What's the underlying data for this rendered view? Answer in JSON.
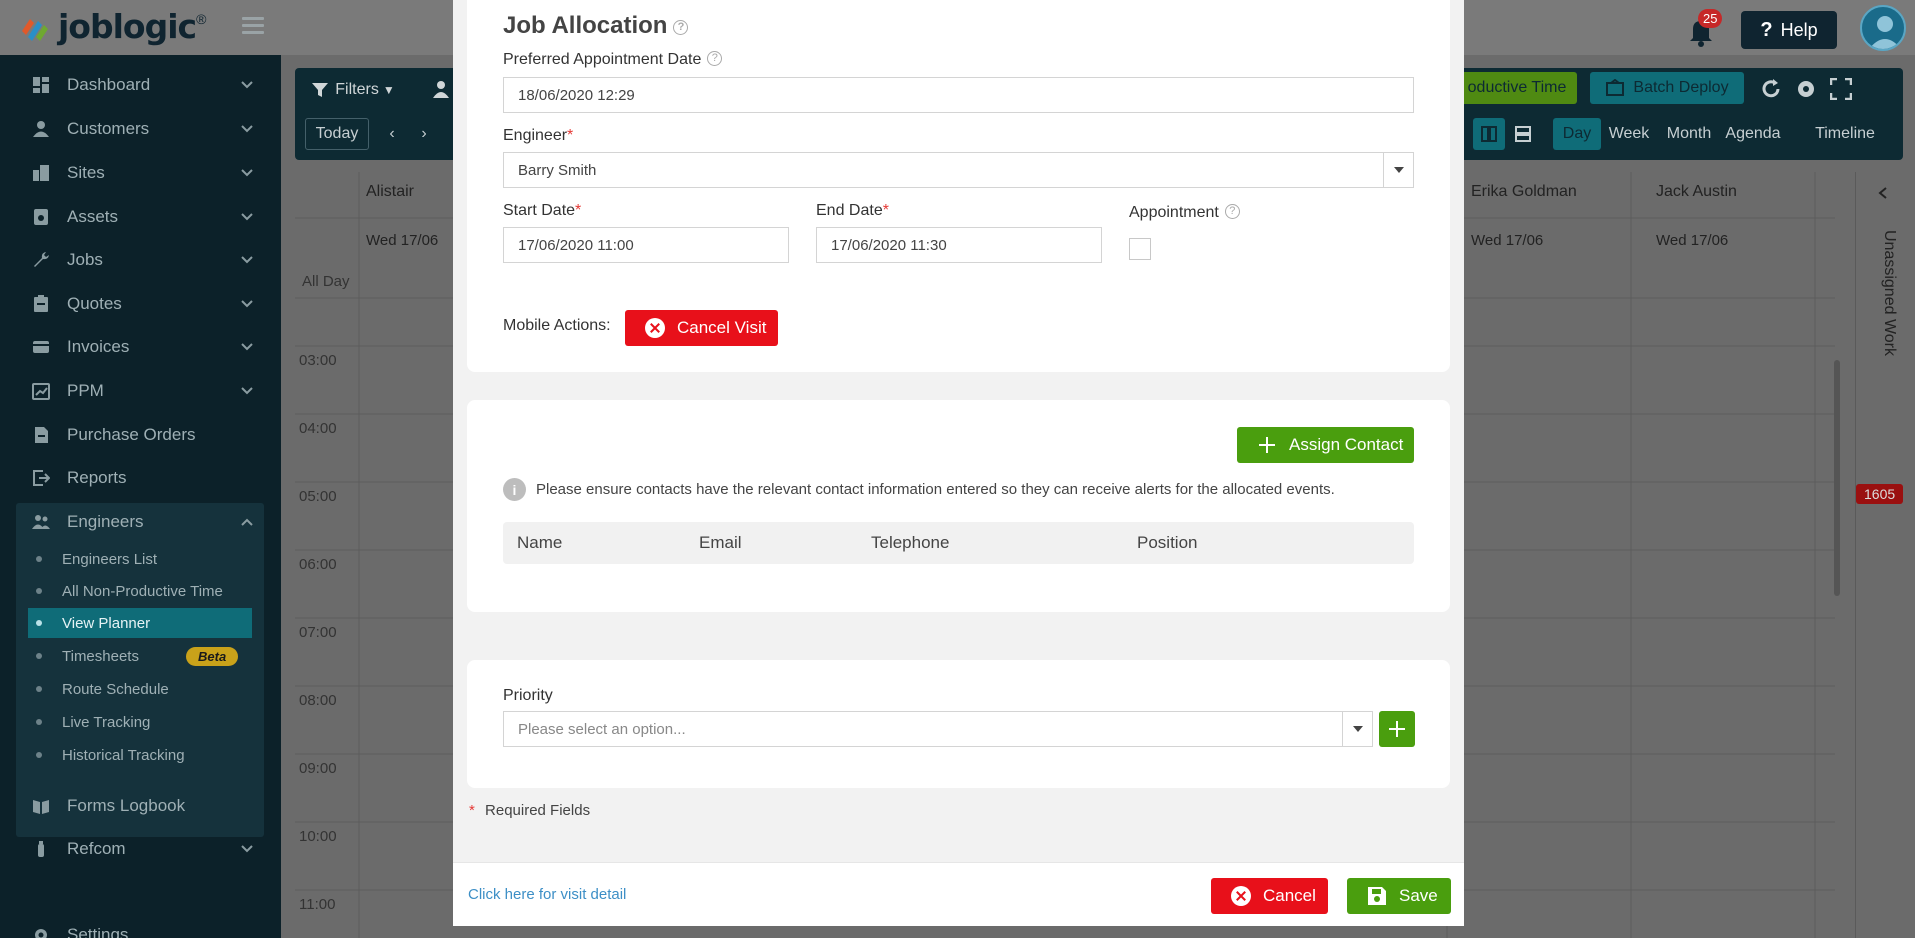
{
  "header": {
    "brand": "joblogic",
    "brand_mark": "®",
    "notifications_count": "25",
    "help_label": "Help"
  },
  "sidebar": {
    "items": [
      {
        "label": "Dashboard",
        "icon": "dashboard-icon"
      },
      {
        "label": "Customers",
        "icon": "customer-icon"
      },
      {
        "label": "Sites",
        "icon": "building-icon"
      },
      {
        "label": "Assets",
        "icon": "asset-icon"
      },
      {
        "label": "Jobs",
        "icon": "wrench-icon"
      },
      {
        "label": "Quotes",
        "icon": "clipboard-icon"
      },
      {
        "label": "Invoices",
        "icon": "card-icon"
      },
      {
        "label": "PPM",
        "icon": "calendar-chart-icon"
      },
      {
        "label": "Purchase Orders",
        "icon": "document-icon"
      },
      {
        "label": "Reports",
        "icon": "export-icon"
      },
      {
        "label": "Engineers",
        "icon": "people-icon"
      }
    ],
    "engineers_sub": [
      {
        "label": "Engineers List"
      },
      {
        "label": "All Non-Productive Time"
      },
      {
        "label": "View Planner"
      },
      {
        "label": "Timesheets",
        "badge": "Beta"
      },
      {
        "label": "Route Schedule"
      },
      {
        "label": "Live Tracking"
      },
      {
        "label": "Historical Tracking"
      }
    ],
    "bottom": [
      {
        "label": "Forms Logbook",
        "icon": "book-icon"
      },
      {
        "label": "Refcom",
        "icon": "cylinder-icon"
      },
      {
        "label": "Settings",
        "icon": "gear-icon"
      }
    ]
  },
  "planner": {
    "filters_label": "Filters",
    "today_label": "Today",
    "non_productive_label": "oductive Time",
    "batch_deploy_label": "Batch Deploy",
    "views": [
      "Day",
      "Week",
      "Month",
      "Agenda",
      "Timeline"
    ],
    "all_day": "All Day",
    "hours": [
      "03:00",
      "04:00",
      "05:00",
      "06:00",
      "07:00",
      "08:00",
      "09:00",
      "10:00",
      "11:00"
    ],
    "columns": [
      {
        "name": "Alistair",
        "date": "Wed 17/06"
      },
      {
        "name": "Erika Goldman",
        "date": "Wed 17/06"
      },
      {
        "name": "Jack Austin",
        "date": "Wed 17/06"
      }
    ],
    "unassigned_label": "Unassigned Work",
    "unassigned_count": "1605"
  },
  "modal": {
    "title": "Job Allocation",
    "preferred_label": "Preferred Appointment Date",
    "preferred_value": "18/06/2020 12:29",
    "engineer_label": "Engineer",
    "engineer_value": "Barry Smith",
    "start_label": "Start Date",
    "start_value": "17/06/2020 11:00",
    "end_label": "End Date",
    "end_value": "17/06/2020 11:30",
    "appointment_label": "Appointment",
    "mobile_actions_label": "Mobile Actions:",
    "cancel_visit_label": "Cancel Visit",
    "assign_contact_label": "Assign Contact",
    "contact_info_note": "Please ensure contacts have the relevant contact information entered so they can receive alerts for the allocated events.",
    "contact_columns": [
      "Name",
      "Email",
      "Telephone",
      "Position"
    ],
    "priority_label": "Priority",
    "priority_placeholder": "Please select an option...",
    "required_star": "*",
    "required_note": "Required Fields",
    "visit_detail_link": "Click here for visit detail",
    "cancel_label": "Cancel",
    "save_label": "Save"
  },
  "colors": {
    "sidebar_bg": "#0c2129",
    "active_nav": "#0f6c78",
    "danger": "#e8101a",
    "success": "#4a9e0e",
    "link": "#3d8fc6"
  }
}
